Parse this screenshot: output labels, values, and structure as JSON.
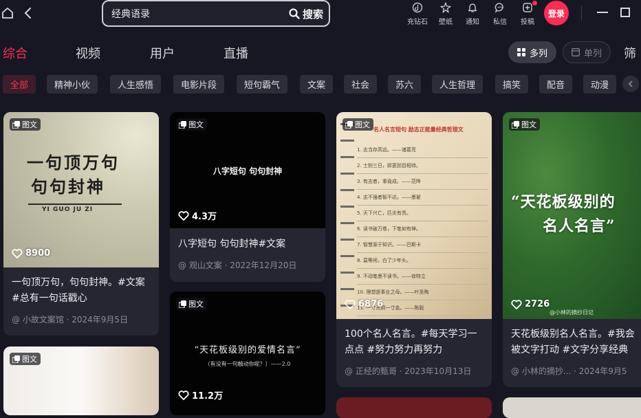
{
  "search": {
    "value": "经典语录",
    "button_label": "搜索"
  },
  "toolbar": {
    "items": [
      {
        "label": "充钻石",
        "icon": "tiktok-coin-icon"
      },
      {
        "label": "壁纸",
        "icon": "wallpaper-icon"
      },
      {
        "label": "通知",
        "icon": "bell-icon"
      },
      {
        "label": "私信",
        "icon": "message-icon"
      },
      {
        "label": "投稿",
        "icon": "upload-icon"
      }
    ],
    "login_label": "登录"
  },
  "tabs": [
    {
      "label": "综合",
      "active": true
    },
    {
      "label": "视频",
      "active": false
    },
    {
      "label": "用户",
      "active": false
    },
    {
      "label": "直播",
      "active": false
    }
  ],
  "view_modes": {
    "multi": "多列",
    "single": "单列"
  },
  "filter_label": "筛",
  "chips": [
    "全部",
    "精神小伙",
    "人生感悟",
    "电影片段",
    "短句霸气",
    "文案",
    "社会",
    "苏六",
    "人生哲理",
    "搞笑",
    "配音",
    "动漫"
  ],
  "badge_label": "图文",
  "cards": [
    {
      "thumb_lines": [
        "一句顶万句",
        "句句封神"
      ],
      "thumb_sub": "YI GUO JU ZI",
      "likes": "8900",
      "title": "一句顶万句，句句封神。#文案 #总有一句话戳心",
      "meta": "@ 小故文案馆 · 2024年9月5日"
    },
    {
      "thumb_lines": [
        "八字短句 句句封神"
      ],
      "likes": "4.3万",
      "title": "八字短句 句句封神#文案",
      "meta": "@ 观山文案 · 2022年12月20日"
    },
    {
      "thumb_lines": [
        "“天花板级别的爱情名言”"
      ],
      "thumb_sub": "（有没有一句触动你呢？）——2.0",
      "likes": "11.2万"
    },
    {
      "thumb_heading": "名人名言短句 励志正能量经典哲理文",
      "thumb_list": [
        "1. 志当存高远。——诸葛亮",
        "2. 士别三日，即更刮目相待。",
        "3. 有志者，事竟成。——范晔",
        "4. 志不强者智不达。——墨翟",
        "5. 天下兴亡，匹夫有责。",
        "6. 读书破万卷，下笔如有神。",
        "7. 智慧源于知识。——巴斯卡",
        "8. 莫等闲，白了少年头。",
        "9. 不动笔墨不读书。——徐特立",
        "10. 理想是事业之母。——叶圣陶",
        "11. 一寸光阴一寸金。——陈毅"
      ],
      "likes": "6876",
      "title": "100个名人名言。#每天学习一点点 #努力努力再努力",
      "meta": "@ 正经的甄哥 · 2023年10月13日"
    },
    {
      "thumb_lines": [
        "“天花板级别的",
        "名人名言”"
      ],
      "thumb_sub": "@小林的摘抄日记",
      "likes": "2726",
      "title": "天花板级别名人名言。#我会被文字打动 #文字分享经典",
      "meta": "@ 小林的摘抄...   · 2024年9月5"
    }
  ],
  "colors": {
    "accent": "#fe2c55",
    "background": "#161722",
    "card": "#252632"
  }
}
